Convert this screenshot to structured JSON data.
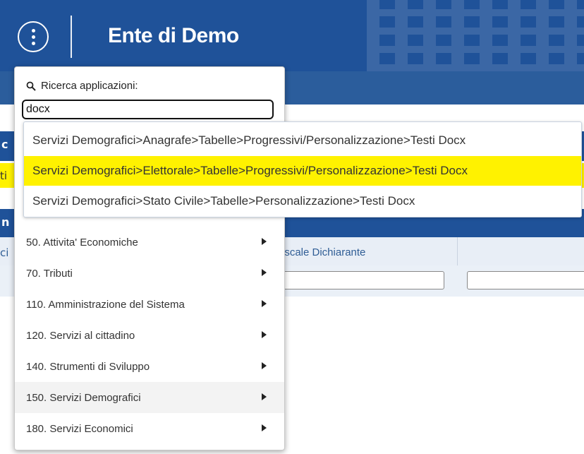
{
  "header": {
    "title": "Ente di Demo"
  },
  "background": {
    "column_header": "iscale Dichiarante",
    "sliver_1": "c",
    "sliver_2": "ti",
    "sliver_3": "n",
    "sliver_4": "ci"
  },
  "search": {
    "label": "Ricerca applicazioni:",
    "value": "docx"
  },
  "results": [
    {
      "text": "Servizi Demografici>Anagrafe>Tabelle>Progressivi/Personalizzazione>Testi Docx",
      "highlighted": false
    },
    {
      "text": "Servizi Demografici>Elettorale>Tabelle>Progressivi/Personalizzazione>Testi Docx",
      "highlighted": true
    },
    {
      "text": "Servizi Demografici>Stato Civile>Tabelle>Personalizzazione>Testi Docx",
      "highlighted": false
    }
  ],
  "menu": [
    {
      "label": "50. Attivita' Economiche"
    },
    {
      "label": "70. Tributi"
    },
    {
      "label": "110. Amministrazione del Sistema"
    },
    {
      "label": "120. Servizi al cittadino"
    },
    {
      "label": "140. Strumenti di Sviluppo"
    },
    {
      "label": "150. Servizi Demografici"
    },
    {
      "label": "180. Servizi Economici"
    }
  ],
  "colors": {
    "header_bg": "#1f5299",
    "highlight": "#fff200",
    "link_text": "#2f5d95"
  },
  "icons": {
    "menu": "vertical-dots-icon",
    "search": "search-icon",
    "submenu": "caret-right-icon"
  }
}
